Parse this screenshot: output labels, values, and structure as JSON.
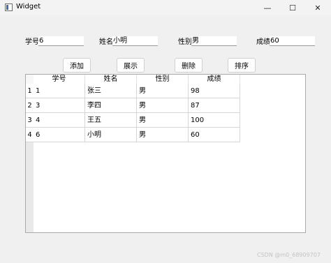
{
  "window": {
    "title": "Widget",
    "minimize_icon": "minimize-icon",
    "maximize_icon": "maximize-icon",
    "close_icon": "close-icon"
  },
  "form": {
    "id_label": "学号",
    "id_value": "6",
    "name_label": "姓名",
    "name_value": "小明",
    "gender_label": "性别",
    "gender_value": "男",
    "score_label": "成绩",
    "score_value": "60"
  },
  "buttons": {
    "add": "添加",
    "show": "展示",
    "delete": "删除",
    "sort": "排序"
  },
  "table": {
    "headers": [
      "学号",
      "姓名",
      "性别",
      "成绩"
    ],
    "row_headers": [
      "1",
      "2",
      "3",
      "4"
    ],
    "rows": [
      [
        "1",
        "张三",
        "男",
        "98"
      ],
      [
        "3",
        "李四",
        "男",
        "87"
      ],
      [
        "4",
        "王五",
        "男",
        "100"
      ],
      [
        "6",
        "小明",
        "男",
        "60"
      ]
    ]
  },
  "watermark": "CSDN @m0_68909707"
}
